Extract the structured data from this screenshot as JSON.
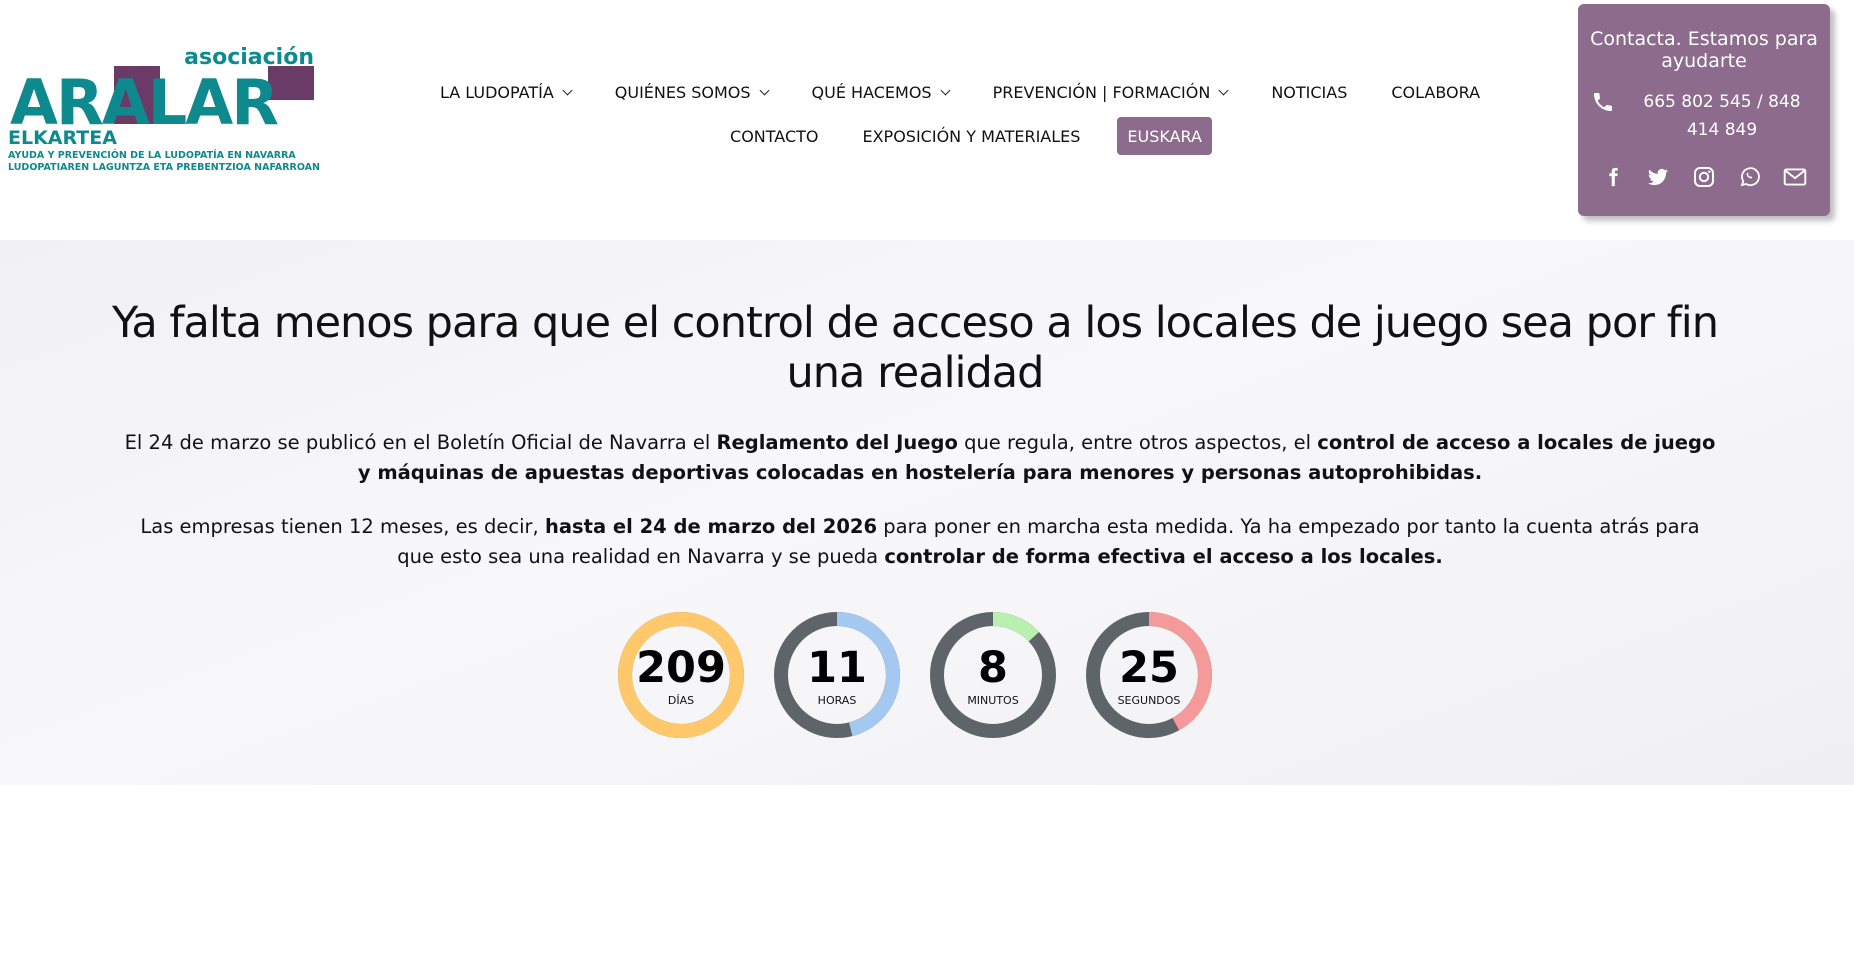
{
  "logo": {
    "top_word": "asociación",
    "main_word": "ARALAR",
    "sub_word": "ELKARTEA",
    "tagline_1": "AYUDA Y PREVENCIÓN DE LA LUDOPATÍA EN NAVARRA",
    "tagline_2": "LUDOPATIAREN LAGUNTZA ETA PREBENTZIOA NAFARROAN"
  },
  "nav": {
    "row1": [
      {
        "label": "LA LUDOPATÍA",
        "dropdown": true
      },
      {
        "label": "QUIÉNES SOMOS",
        "dropdown": true
      },
      {
        "label": "QUÉ HACEMOS",
        "dropdown": true
      },
      {
        "label": "PREVENCIÓN | FORMACIÓN",
        "dropdown": true
      },
      {
        "label": "NOTICIAS",
        "dropdown": false
      },
      {
        "label": "COLABORA",
        "dropdown": false
      }
    ],
    "row2": [
      {
        "label": "CONTACTO"
      },
      {
        "label": "EXPOSICIÓN Y MATERIALES"
      },
      {
        "label": "EUSKARA"
      }
    ]
  },
  "contact": {
    "title": "Contacta. Estamos para ayudarte",
    "phone": "665 802 545 / 848 414 849",
    "social_icons": [
      "facebook-icon",
      "twitter-icon",
      "instagram-icon",
      "whatsapp-icon",
      "mail-icon"
    ]
  },
  "hero": {
    "title": "Ya falta menos para que el control de acceso a los locales de juego sea por fin una realidad",
    "para1": {
      "t1": "El 24 de marzo se publicó en el Boletín Oficial de Navarra el ",
      "b1": "Reglamento del Juego",
      "t2": " que regula, entre otros aspectos, el ",
      "b2": "control de acceso a locales de juego y máquinas de apuestas deportivas colocadas en hostelería para menores y personas autoprohibidas."
    },
    "para2": {
      "t1": "Las empresas tienen 12 meses, es decir, ",
      "b1": "hasta el 24 de marzo del 2026",
      "t2": " para poner en marcha esta medida. Ya ha empezado por tanto la cuenta atrás para que esto sea una realidad en Navarra y se pueda ",
      "b2": "controlar de forma efectiva el acceso a los locales."
    }
  },
  "countdown": [
    {
      "value": "209",
      "label": "DÍAS",
      "fraction": 1.0,
      "color": "#ffc96b"
    },
    {
      "value": "11",
      "label": "HORAS",
      "fraction": 0.46,
      "color": "#a4c8f0"
    },
    {
      "value": "8",
      "label": "MINUTOS",
      "fraction": 0.13,
      "color": "#b9f0b0"
    },
    {
      "value": "25",
      "label": "SEGUNDOS",
      "fraction": 0.42,
      "color": "#f59a9a"
    }
  ],
  "colors": {
    "accent_purple": "#8c6b8c",
    "logo_teal": "#0e8a8f",
    "logo_purple": "#6a3b66",
    "ring_track": "#5e6468"
  }
}
